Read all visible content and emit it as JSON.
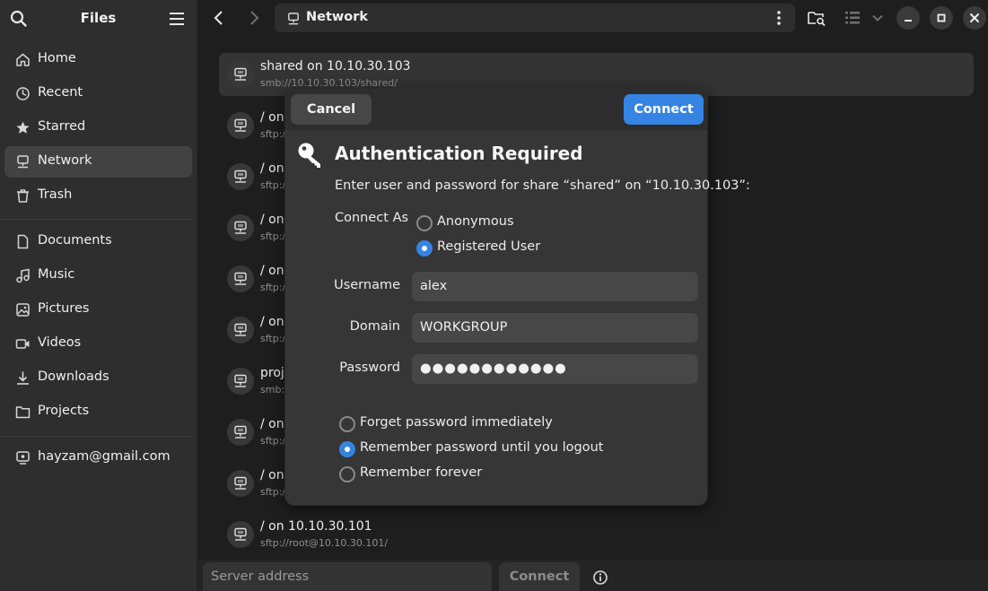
{
  "sidebar": {
    "title": "Files",
    "places": [
      {
        "label": "Home",
        "icon": "home-icon",
        "active": false
      },
      {
        "label": "Recent",
        "icon": "clock-icon",
        "active": false
      },
      {
        "label": "Starred",
        "icon": "star-icon",
        "active": false
      },
      {
        "label": "Network",
        "icon": "network-icon",
        "active": true
      },
      {
        "label": "Trash",
        "icon": "trash-icon",
        "active": false
      }
    ],
    "folders": [
      {
        "label": "Documents",
        "icon": "document-icon"
      },
      {
        "label": "Music",
        "icon": "music-icon"
      },
      {
        "label": "Pictures",
        "icon": "picture-icon"
      },
      {
        "label": "Videos",
        "icon": "video-icon"
      },
      {
        "label": "Downloads",
        "icon": "download-icon"
      },
      {
        "label": "Projects",
        "icon": "folder-icon"
      }
    ],
    "account": {
      "label": "hayzam@gmail.com",
      "icon": "online-account-icon"
    }
  },
  "header": {
    "location": "Network"
  },
  "list": {
    "rows": [
      {
        "name": "shared on 10.10.30.103",
        "sub": "smb://10.10.30.103/shared/",
        "selected": true
      },
      {
        "name": "/ on",
        "sub": "sftp:/"
      },
      {
        "name": "/ on",
        "sub": "sftp:/"
      },
      {
        "name": "/ on",
        "sub": "sftp:/"
      },
      {
        "name": "/ on",
        "sub": "sftp:/"
      },
      {
        "name": "/ on",
        "sub": "sftp:/"
      },
      {
        "name": "proj",
        "sub": "smb:"
      },
      {
        "name": "/ on",
        "sub": "sftp:/"
      },
      {
        "name": "/ on",
        "sub": "sftp:/"
      },
      {
        "name": "/ on 10.10.30.101",
        "sub": "sftp://root@10.10.30.101/"
      }
    ]
  },
  "bottom": {
    "server_placeholder": "Server address",
    "connect_label": "Connect"
  },
  "dialog": {
    "cancel_label": "Cancel",
    "connect_label": "Connect",
    "title": "Authentication Required",
    "message": "Enter user and password for share “shared” on “10.10.30.103”:",
    "connect_as_label": "Connect As",
    "connect_as_options": [
      {
        "label": "Anonymous",
        "selected": false
      },
      {
        "label": "Registered User",
        "selected": true
      }
    ],
    "username_label": "Username",
    "username_value": "alex",
    "domain_label": "Domain",
    "domain_value": "WORKGROUP",
    "password_label": "Password",
    "password_value": "●●●●●●●●●●●●",
    "remember_options": [
      {
        "label": "Forget password immediately",
        "selected": false
      },
      {
        "label": "Remember password until you logout",
        "selected": true
      },
      {
        "label": "Remember forever",
        "selected": false
      }
    ]
  },
  "colors": {
    "accent": "#3584e4",
    "window_bg": "#1e1e1e",
    "sidebar_bg": "#2e2e2e",
    "dialog_bg": "#363636"
  }
}
